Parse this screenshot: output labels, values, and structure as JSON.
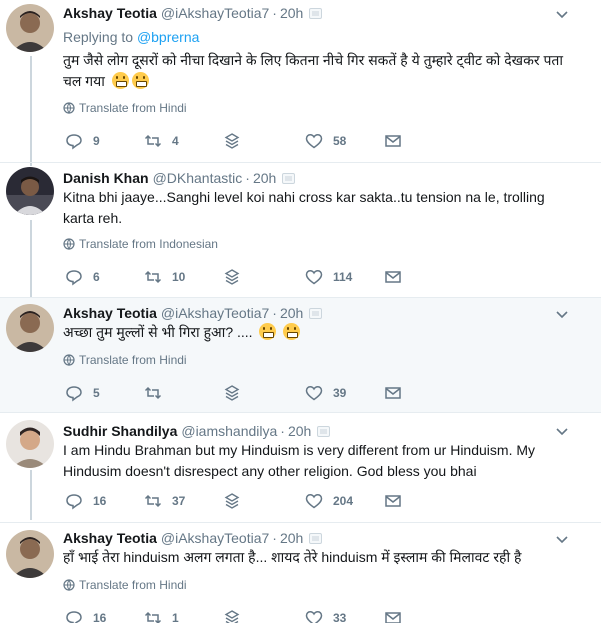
{
  "tweets": [
    {
      "name": "Akshay Teotia",
      "handle": "@iAkshayTeotia7",
      "time": "20h",
      "replying_prefix": "Replying to",
      "replying_to": "@bprerna",
      "text": "तुम जैसे लोग दूसरों को नीचा दिखाने के लिए कितना नीचे गिर सकतें है ये तुम्हारे ट्वीट को देखकर पता चल गया",
      "emoji_count": 2,
      "translate": "Translate from Hindi",
      "replies": "9",
      "retweets": "4",
      "likes": "58",
      "avatar_color": "#8a7360"
    },
    {
      "name": "Danish Khan",
      "handle": "@DKhantastic",
      "time": "20h",
      "text": "Kitna bhi jaaye...Sanghi level koi nahi cross kar sakta..tu tension na le, trolling karta reh.",
      "emoji_count": 0,
      "translate": "Translate from Indonesian",
      "replies": "6",
      "retweets": "10",
      "likes": "114",
      "avatar_color": "#3a3a45"
    },
    {
      "name": "Akshay Teotia",
      "handle": "@iAkshayTeotia7",
      "time": "20h",
      "text": "अच्छा तुम मुल्लों से भी गिरा हुआ? ....",
      "emoji_count": 2,
      "translate": "Translate from Hindi",
      "replies": "5",
      "retweets": "",
      "likes": "39",
      "avatar_color": "#8a7360"
    },
    {
      "name": "Sudhir Shandilya",
      "handle": "@iamshandilya",
      "time": "20h",
      "text": "I am Hindu Brahman but my Hinduism is very different from ur Hinduism. My Hindusim doesn't disrespect any other religion. God bless you bhai",
      "emoji_count": 0,
      "translate": "",
      "replies": "16",
      "retweets": "37",
      "likes": "204",
      "avatar_color": "#c9b8a8"
    },
    {
      "name": "Akshay Teotia",
      "handle": "@iAkshayTeotia7",
      "time": "20h",
      "text": "हाँ भाई तेरा hinduism अलग लगता है... शायद तेरे hinduism में इस्लाम की मिलावट रही है",
      "emoji_count": 0,
      "translate": "Translate from Hindi",
      "replies": "16",
      "retweets": "1",
      "likes": "33",
      "avatar_color": "#8a7360"
    }
  ],
  "colors": {
    "link": "#1da1f2",
    "muted": "#657786",
    "thread_line": "#ccd6dd",
    "highlight_bg": "#f5f8fa"
  }
}
